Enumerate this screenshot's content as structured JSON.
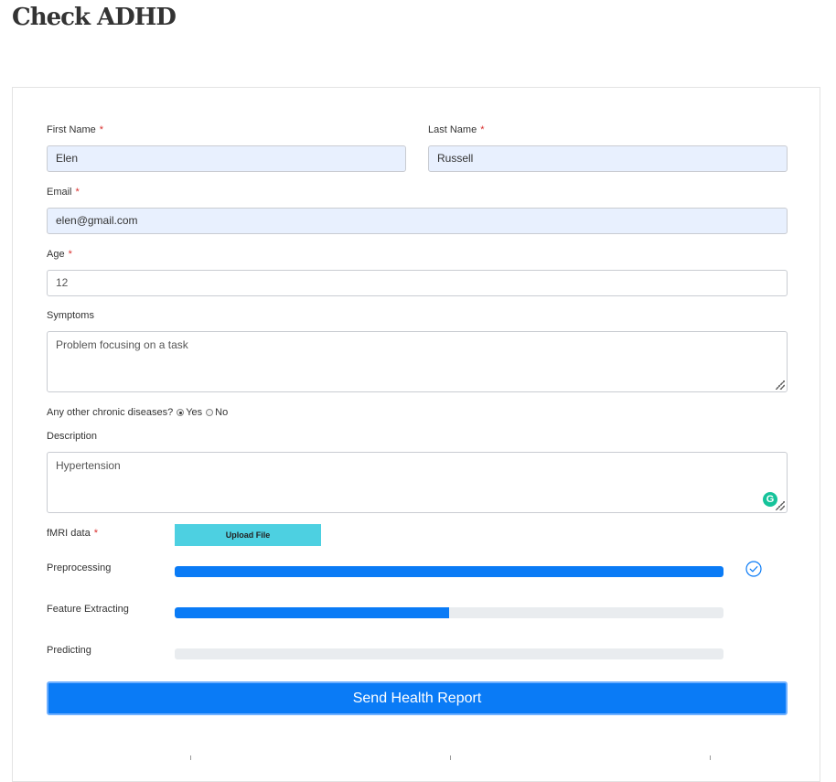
{
  "page": {
    "title": "Check ADHD"
  },
  "form": {
    "required_mark": "*",
    "first_name": {
      "label": "First Name",
      "value": "Elen"
    },
    "last_name": {
      "label": "Last Name",
      "value": "Russell"
    },
    "email": {
      "label": "Email",
      "value": "elen@gmail.com"
    },
    "age": {
      "label": "Age",
      "value": "12"
    },
    "symptoms": {
      "label": "Symptoms",
      "value": "Problem focusing on a task"
    },
    "chronic": {
      "label": "Any other chronic diseases?",
      "options": [
        "Yes",
        "No"
      ],
      "selected": "Yes"
    },
    "description": {
      "label": "Description",
      "value": "Hypertension"
    },
    "fmri": {
      "label": "fMRI data",
      "button": "Upload File"
    },
    "progress": [
      {
        "label": "Preprocessing",
        "percent": 100,
        "done": true
      },
      {
        "label": "Feature Extracting",
        "percent": 50,
        "done": false
      },
      {
        "label": "Predicting",
        "percent": 0,
        "done": false
      }
    ],
    "submit": "Send Health Report"
  },
  "colors": {
    "accent": "#0a7bf6",
    "upload_button": "#4dd0e1",
    "required": "#d9312f",
    "autofill_bg": "#e8f0fe",
    "grammarly": "#15c39a"
  },
  "icons": {
    "done": "check-circle-icon",
    "textarea_extension": "grammarly-icon"
  }
}
